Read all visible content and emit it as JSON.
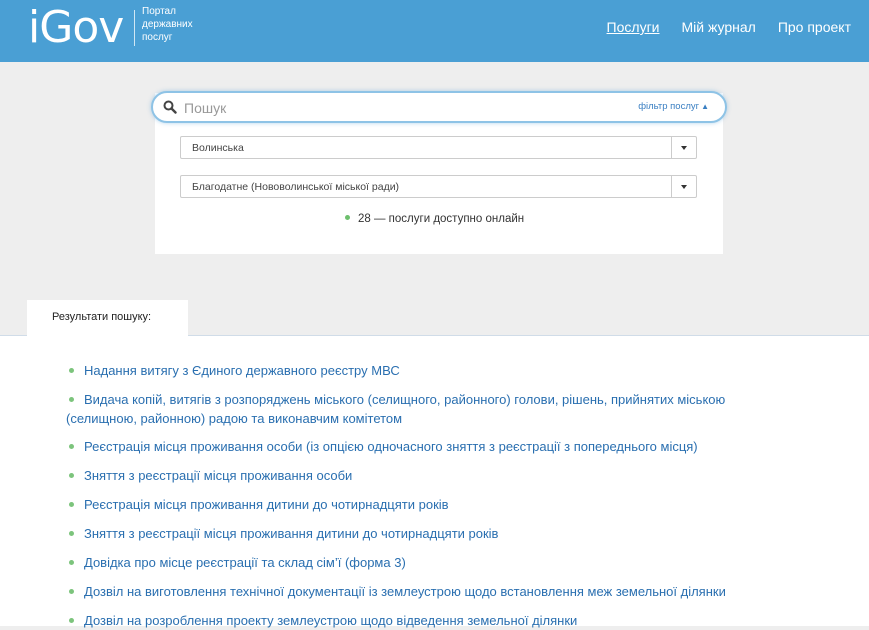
{
  "header": {
    "logo": "iGov",
    "subtitle": [
      "Портал",
      "державних",
      "послуг"
    ],
    "nav": [
      "Послуги",
      "Мій журнал",
      "Про проект"
    ]
  },
  "search": {
    "placeholder": "Пошук",
    "filter_label": "фільтр послуг",
    "region": "Волинська",
    "locality": "Благодатне (Нововолинської міської ради)",
    "status_text": "28 — послуги доступно онлайн"
  },
  "results": {
    "tab_label": "Результати пошуку:",
    "items": [
      "Надання витягу з Єдиного державного реєстру МВС",
      "Видача копій, витягів з розпоряджень міського (селищного, районного) голови, рішень, прийнятих міською (селищною, районною) радою та виконавчим комітетом",
      "Реєстрація місця проживання особи (із опцією одночасного зняття з реєстрації з попереднього місця)",
      "Зняття з реєстрації місця проживання особи",
      "Реєстрація місця проживання дитини до чотирнадцяти років",
      "Зняття з реєстрації місця проживання дитини до чотирнадцяти років",
      "Довідка про місце реєстрації та склад сім’ї (форма 3)",
      "Дозвіл на виготовлення технічної документації із землеустрою щодо встановлення меж земельної ділянки",
      "Дозвіл на розроблення проекту землеустрою щодо відведення земельної ділянки"
    ]
  },
  "colors": {
    "header_bg": "#4a9fd4",
    "link": "#2a6fb0",
    "bullet": "#7cc47c"
  }
}
